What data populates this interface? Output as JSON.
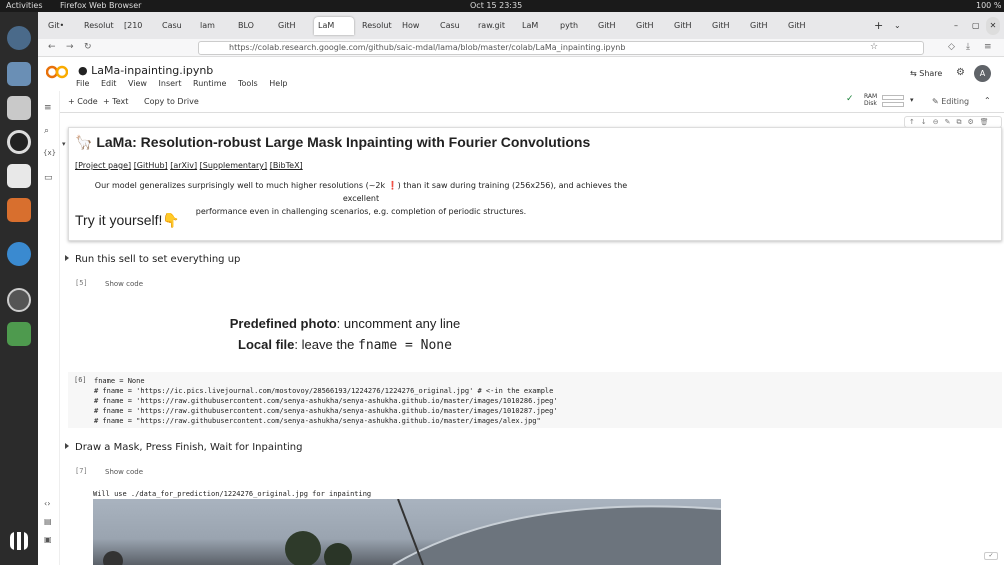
{
  "system": {
    "activities": "Activities",
    "browser_name": "Firefox Web Browser",
    "clock": "Oct 15  23:35",
    "battery": "100 %"
  },
  "tabs": [
    "Git•",
    "Resolut",
    "[210",
    "Casu",
    "lam",
    "BLO",
    "GitH",
    "LaM",
    "Resolut",
    "How",
    "Casu",
    "raw.git",
    "LaM",
    "pyth",
    "GitH",
    "GitH",
    "GitH",
    "GitH",
    "GitH",
    "GitH"
  ],
  "url": {
    "text": "https://colab.research.google.com/github/saic-mdal/lama/blob/master/colab/LaMa_inpainting.ipynb"
  },
  "colab": {
    "notebook_title": "LaMa-inpainting.ipynb",
    "menu": [
      "File",
      "Edit",
      "View",
      "Insert",
      "Runtime",
      "Tools",
      "Help"
    ],
    "share": "Share",
    "avatar": "A",
    "toolbar": {
      "code": "+ Code",
      "text": "+ Text",
      "copy": "Copy to Drive",
      "ram": "RAM",
      "disk": "Disk",
      "editing": "Editing"
    }
  },
  "notebook": {
    "title": "LaMa: Resolution-robust Large Mask Inpainting with Fourier Convolutions",
    "links": [
      "[Project page]",
      "[GitHub]",
      "[arXiv]",
      "[Supplementary]",
      "[BibTeX]"
    ],
    "description_line1": "Our model generalizes surprisingly well to much higher resolutions (~2k ❗️) than it saw during training (256x256), and achieves the excellent",
    "description_line2": "performance even in challenging scenarios, e.g. completion of periodic structures.",
    "try": "Try it yourself!👇",
    "section1": "Run this sell to set everything up",
    "cell5": "[5]",
    "show_code": "Show code",
    "predefined_bold": "Predefined photo",
    "predefined_rest": ": uncomment any line",
    "local_bold": "Local file",
    "local_rest": ": leave the ",
    "local_code": "fname = None",
    "cell6": "[6]",
    "code_lines": [
      "fname = None",
      "# fname = 'https://ic.pics.livejournal.com/mostovoy/28566193/1224276/1224276_original.jpg' # <-in the example",
      "# fname = 'https://raw.githubusercontent.com/senya-ashukha/senya-ashukha.github.io/master/images/1010286.jpeg'",
      "# fname = 'https://raw.githubusercontent.com/senya-ashukha/senya-ashukha.github.io/master/images/1010287.jpeg'",
      "# fname = \"https://raw.githubusercontent.com/senya-ashukha/senya-ashukha.github.io/master/images/alex.jpg\""
    ],
    "section2": "Draw a Mask, Press Finish, Wait for Inpainting",
    "cell7": "[7]",
    "output": "Will use ./data_for_prediction/1224276_original.jpg for inpainting"
  }
}
